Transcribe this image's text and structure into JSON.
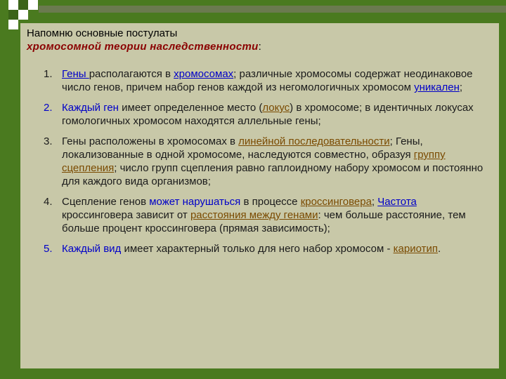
{
  "heading": {
    "line1": "Напомню основные постулаты",
    "line2_em": "хромосомной теории наследственности",
    "line2_tail": ":"
  },
  "items": [
    {
      "num": "1.",
      "p": [
        "Гены ",
        "располагаются в ",
        "хромосомах",
        "; различные хромосомы содержат неодинаковое число генов, причем набор генов каждой из негомологичных хромосом ",
        "уникален",
        ";"
      ]
    },
    {
      "num": "2.",
      "p": [
        "Каждый ген",
        " имеет определенное место (",
        "локус",
        ") в хромосоме; в идентичных локусах гомологичных хромосом находятся аллельные гены;"
      ]
    },
    {
      "num": "3.",
      "p": [
        "Гены расположены в хромосомах в ",
        "линейной последовательности",
        "; Гены, локализованные в одной хромосоме, наследуются совместно, образуя ",
        "группу сцепления",
        "; число групп сцепления равно гаплоидному набору хромосом и постоянно для каждого вида организмов;"
      ]
    },
    {
      "num": "4.",
      "p": [
        "Сцепление генов ",
        "может нарушаться",
        " в процессе ",
        "кроссинговера",
        "; ",
        "Частота",
        " кроссинговера зависит от ",
        "расстояния между генами",
        ": чем больше расстояние, тем больше процент кроссинговера (прямая зависимость);"
      ]
    },
    {
      "num": "5.",
      "p": [
        "Каждый вид",
        " имеет характерный только для него набор хромосом - ",
        "кариотип",
        "."
      ]
    }
  ],
  "colors": {
    "background": "#4a7a1f",
    "panel": "#c8c8a8",
    "accent_blue": "#0000c8",
    "accent_gold": "#7a4a00",
    "heading_em": "#8a0000"
  }
}
